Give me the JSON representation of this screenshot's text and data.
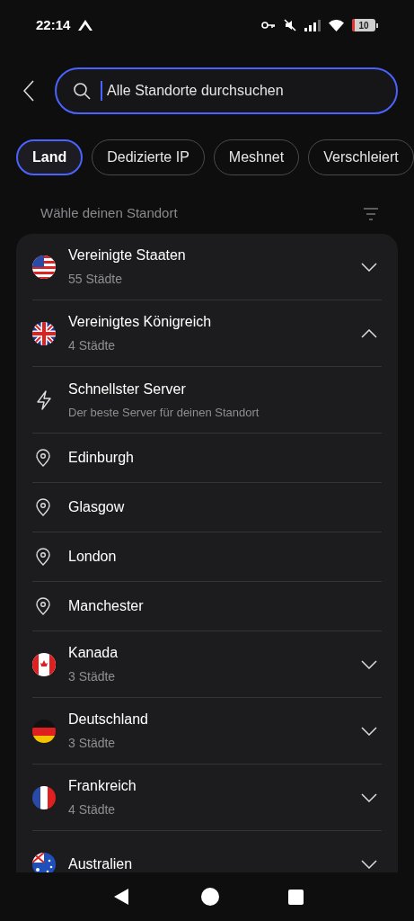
{
  "status_bar": {
    "time": "22:14",
    "battery": "10"
  },
  "search": {
    "placeholder": "Alle Standorte durchsuchen",
    "focused": true
  },
  "tabs": [
    {
      "label": "Land",
      "selected": true
    },
    {
      "label": "Dedizierte IP",
      "selected": false
    },
    {
      "label": "Meshnet",
      "selected": false
    },
    {
      "label": "Verschleiert",
      "selected": false
    }
  ],
  "section_title": "Wähle deinen Standort",
  "locations": [
    {
      "kind": "country",
      "name": "Vereinigte Staaten",
      "subtitle": "55 Städte",
      "expanded": false
    },
    {
      "kind": "country",
      "name": "Vereinigtes Königreich",
      "subtitle": "4 Städte",
      "expanded": true
    },
    {
      "kind": "fastest",
      "name": "Schnellster Server",
      "subtitle": "Der beste Server für deinen Standort"
    },
    {
      "kind": "city",
      "name": "Edinburgh"
    },
    {
      "kind": "city",
      "name": "Glasgow"
    },
    {
      "kind": "city",
      "name": "London"
    },
    {
      "kind": "city",
      "name": "Manchester"
    },
    {
      "kind": "country",
      "name": "Kanada",
      "subtitle": "3 Städte",
      "expanded": false
    },
    {
      "kind": "country",
      "name": "Deutschland",
      "subtitle": "3 Städte",
      "expanded": false
    },
    {
      "kind": "country",
      "name": "Frankreich",
      "subtitle": "4 Städte",
      "expanded": false
    },
    {
      "kind": "country",
      "name": "Australien",
      "expanded": false
    }
  ]
}
